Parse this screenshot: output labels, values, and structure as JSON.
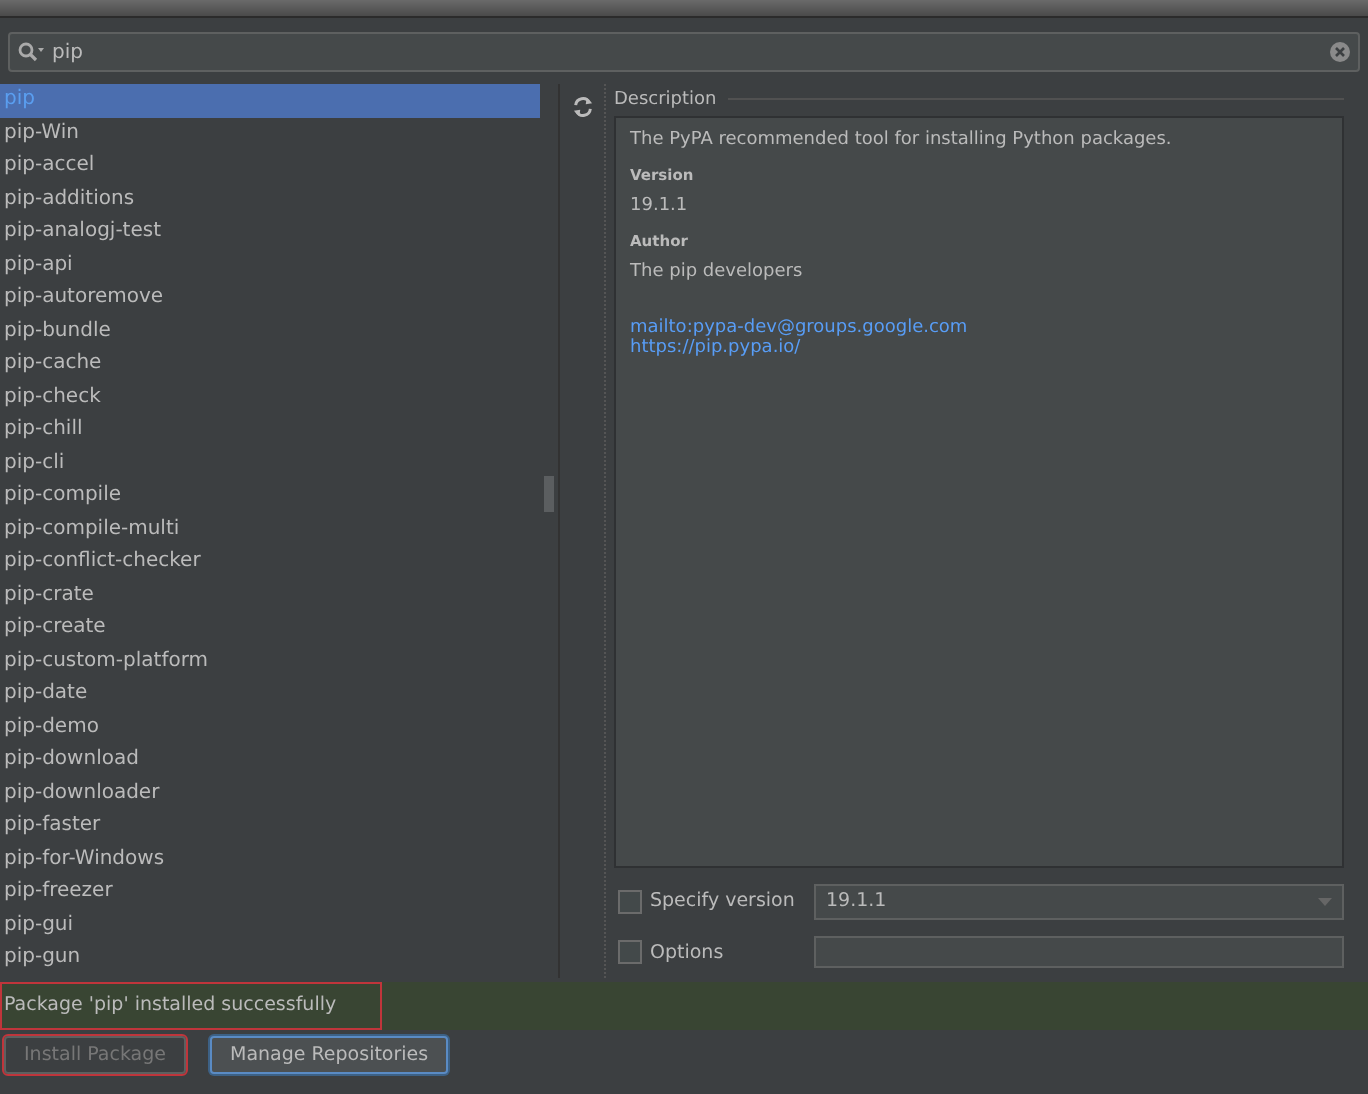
{
  "search": {
    "value": "pip"
  },
  "packages": [
    {
      "name": "pip",
      "selected": true
    },
    {
      "name": "pip-Win",
      "selected": false
    },
    {
      "name": "pip-accel",
      "selected": false
    },
    {
      "name": "pip-additions",
      "selected": false
    },
    {
      "name": "pip-analogj-test",
      "selected": false
    },
    {
      "name": "pip-api",
      "selected": false
    },
    {
      "name": "pip-autoremove",
      "selected": false
    },
    {
      "name": "pip-bundle",
      "selected": false
    },
    {
      "name": "pip-cache",
      "selected": false
    },
    {
      "name": "pip-check",
      "selected": false
    },
    {
      "name": "pip-chill",
      "selected": false
    },
    {
      "name": "pip-cli",
      "selected": false
    },
    {
      "name": "pip-compile",
      "selected": false
    },
    {
      "name": "pip-compile-multi",
      "selected": false
    },
    {
      "name": "pip-conflict-checker",
      "selected": false
    },
    {
      "name": "pip-crate",
      "selected": false
    },
    {
      "name": "pip-create",
      "selected": false
    },
    {
      "name": "pip-custom-platform",
      "selected": false
    },
    {
      "name": "pip-date",
      "selected": false
    },
    {
      "name": "pip-demo",
      "selected": false
    },
    {
      "name": "pip-download",
      "selected": false
    },
    {
      "name": "pip-downloader",
      "selected": false
    },
    {
      "name": "pip-faster",
      "selected": false
    },
    {
      "name": "pip-for-Windows",
      "selected": false
    },
    {
      "name": "pip-freezer",
      "selected": false
    },
    {
      "name": "pip-gui",
      "selected": false
    },
    {
      "name": "pip-gun",
      "selected": false
    }
  ],
  "description": {
    "title": "Description",
    "summary": "The PyPA recommended tool for installing Python packages.",
    "version_label": "Version",
    "version": "19.1.1",
    "author_label": "Author",
    "author": "The pip developers",
    "links": [
      "mailto:pypa-dev@groups.google.com",
      "https://pip.pypa.io/"
    ]
  },
  "options": [
    {
      "kind": "select",
      "label": "Specify version",
      "checked": false,
      "value": "19.1.1"
    },
    {
      "kind": "text",
      "label": "Options",
      "checked": false
    }
  ],
  "status": "Package 'pip' installed successfully",
  "buttons": [
    {
      "label": "Install Package",
      "disabled": true,
      "focused": false
    },
    {
      "label": "Manage Repositories",
      "disabled": false,
      "focused": true
    }
  ]
}
